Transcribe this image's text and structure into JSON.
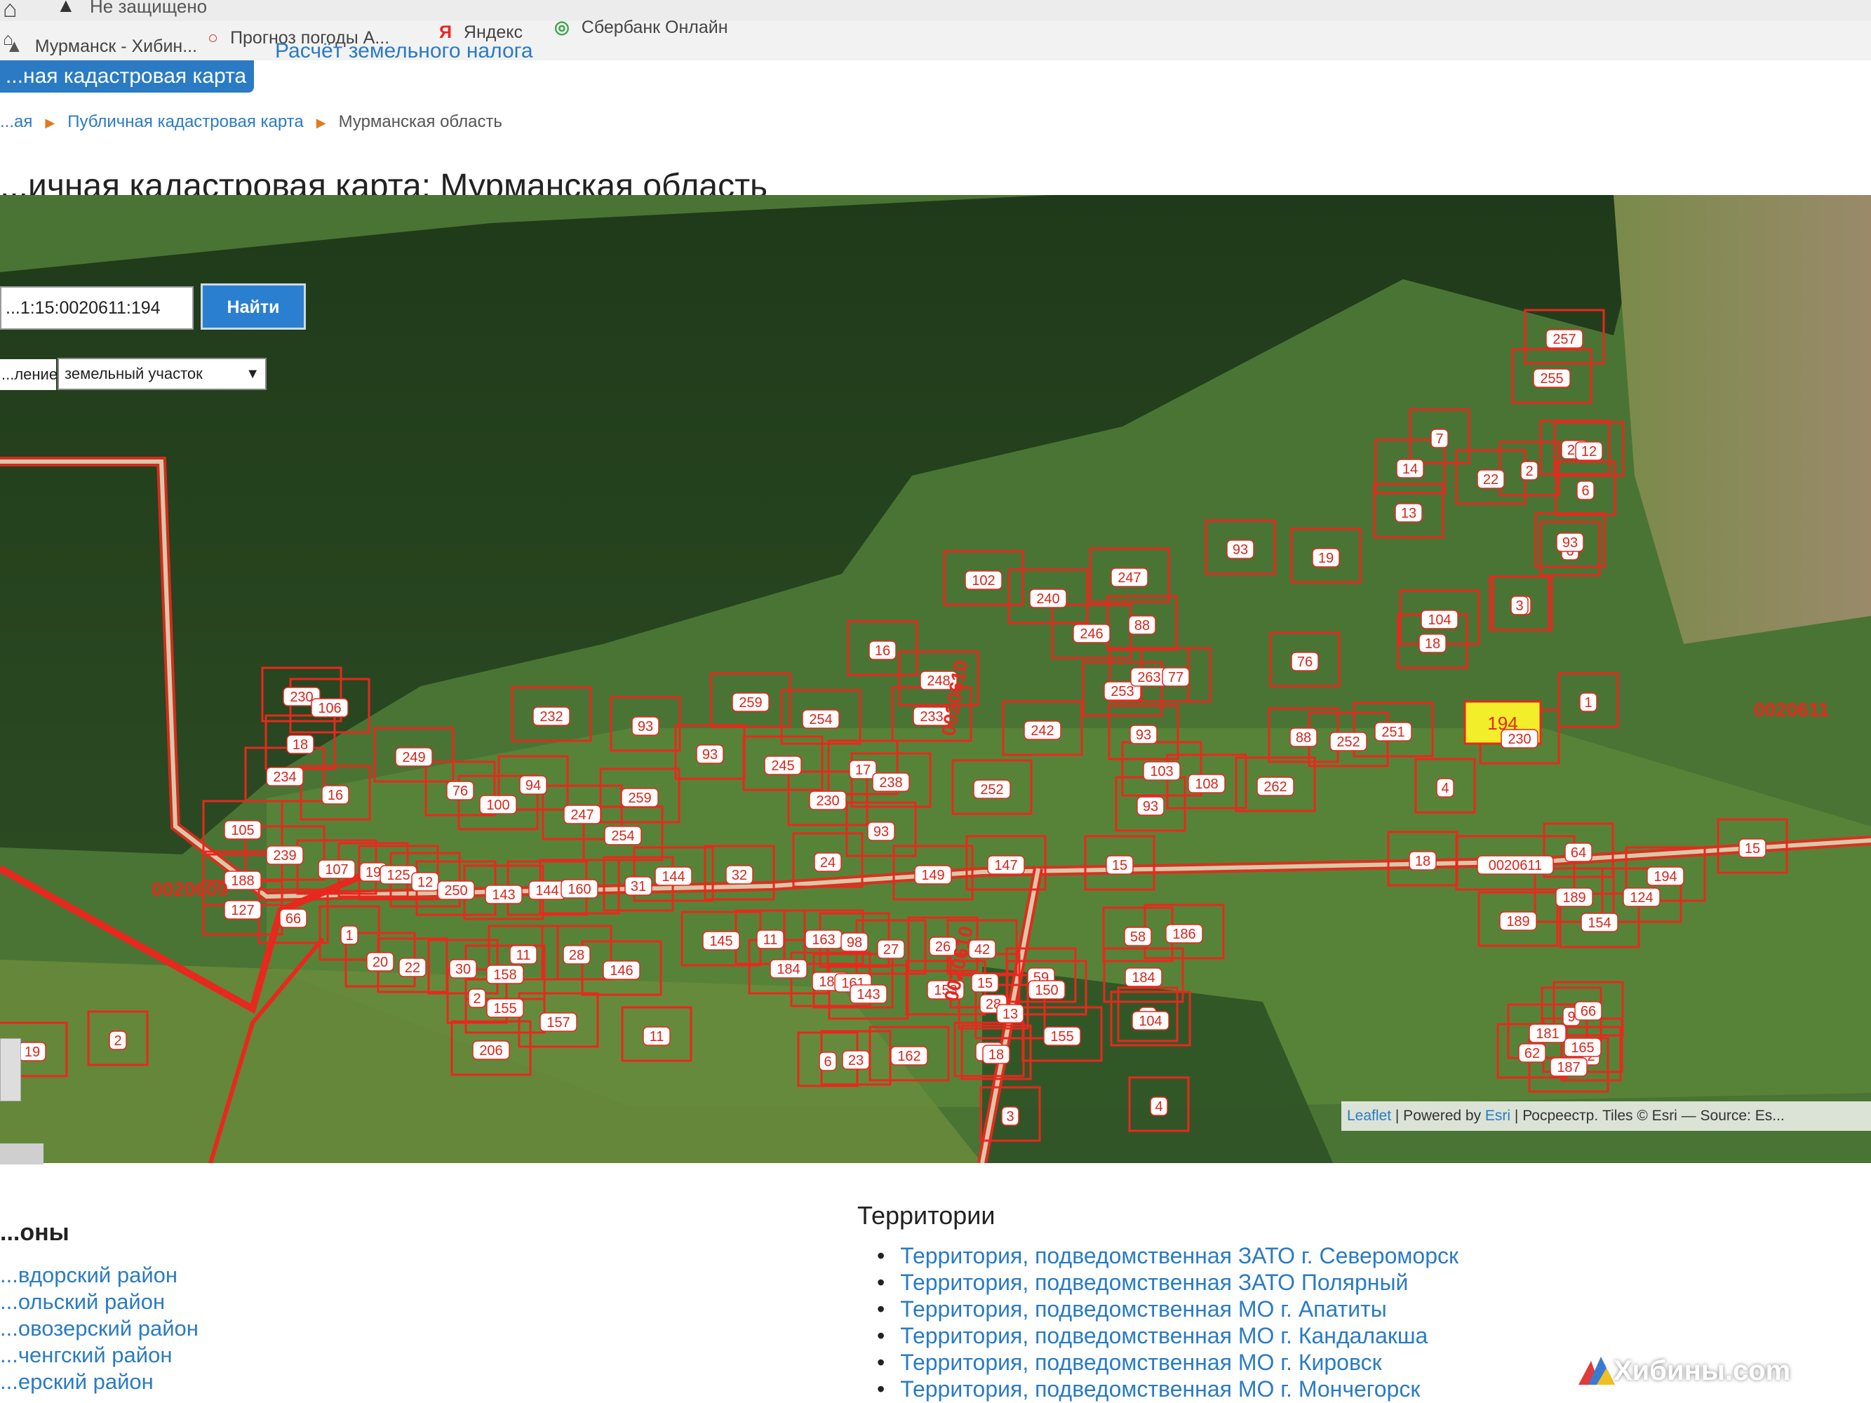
{
  "browser": {
    "security_text": "Не защищено",
    "bookmarks": [
      {
        "icon": "⌂",
        "label": ""
      },
      {
        "icon": "▲",
        "label": "Мурманск - Хибин..."
      },
      {
        "icon": "○",
        "label": "Прогноз погоды А..."
      },
      {
        "icon": "Я",
        "label": "Яндекс"
      },
      {
        "icon": "◎",
        "label": "Сбербанк Онлайн"
      }
    ]
  },
  "header": {
    "nav_active": "...ная кадастровая карта",
    "nav_link": "Расчёт земельного налога"
  },
  "breadcrumb": {
    "home": "...ая",
    "section": "Публичная кадастровая карта",
    "current": "Мурманская область"
  },
  "page_title": "...ичная кадастровая карта: Мурманская область",
  "map": {
    "search_value": "...1:15:0020611:194",
    "find_label": "Найти",
    "select_label": "...ление",
    "select_value": "земельный участок",
    "quarters": [
      "0020609",
      "0020610",
      "0020610",
      "0020611"
    ],
    "attribution": {
      "leaflet": "Leaflet",
      "sep1": " | Powered by ",
      "esri": "Esri",
      "rest": " | Росреестр. Tiles © Esri — Source: Es..."
    },
    "highlighted_parcel": "194",
    "parcels": [
      "257",
      "255",
      "7",
      "14",
      "22",
      "2",
      "21",
      "12",
      "6",
      "13",
      "93",
      "6",
      "19",
      "93",
      "3",
      "102",
      "240",
      "247",
      "88",
      "18",
      "104",
      "3",
      "16",
      "246",
      "248",
      "253",
      "263",
      "77",
      "76",
      "1",
      "233",
      "259",
      "230",
      "230",
      "106",
      "232",
      "93",
      "254",
      "242",
      "93",
      "88",
      "252",
      "251",
      "18",
      "249",
      "93",
      "245",
      "17",
      "238",
      "252",
      "103",
      "108",
      "93",
      "262",
      "4",
      "234",
      "16",
      "76",
      "100",
      "94",
      "247",
      "259",
      "254",
      "230",
      "93",
      "105",
      "239",
      "107",
      "19",
      "125",
      "12",
      "250",
      "143",
      "144",
      "160",
      "31",
      "144",
      "32",
      "24",
      "149",
      "147",
      "15",
      "15",
      "18",
      "0020611",
      "64",
      "194",
      "188",
      "189",
      "127",
      "66",
      "124",
      "1",
      "20",
      "22",
      "30",
      "158",
      "11",
      "28",
      "146",
      "145",
      "11",
      "163",
      "98",
      "27",
      "26",
      "42",
      "59",
      "58",
      "184",
      "186",
      "189",
      "154",
      "155",
      "9",
      "150",
      "62",
      "2",
      "184",
      "186",
      "161",
      "143",
      "153",
      "104",
      "155",
      "157",
      "2",
      "11",
      "28",
      "15",
      "9",
      "66",
      "181",
      "187",
      "165",
      "6",
      "23",
      "162",
      "13",
      "12",
      "3",
      "4",
      "2",
      "19",
      "206",
      "18"
    ]
  },
  "regions": {
    "title": "...оны",
    "items": [
      "...вдорский район",
      "...ольский район",
      "...овозерский район",
      "...ченгский район",
      "...ерский район"
    ]
  },
  "territories": {
    "title": "Территории",
    "items": [
      "Территория, подведомственная ЗАТО г. Североморск",
      "Территория, подведомственная ЗАТО Полярный",
      "Территория, подведомственная МО г. Апатиты",
      "Территория, подведомственная МО г. Кандалакша",
      "Территория, подведомственная МО г. Кировск",
      "Территория, подведомственная МО г. Мончегорск"
    ]
  },
  "watermark": "Хибины.com",
  "colors": {
    "link": "#2a7bc4",
    "parcel_border": "#e8281e",
    "highlight": "#f2ee2a"
  }
}
